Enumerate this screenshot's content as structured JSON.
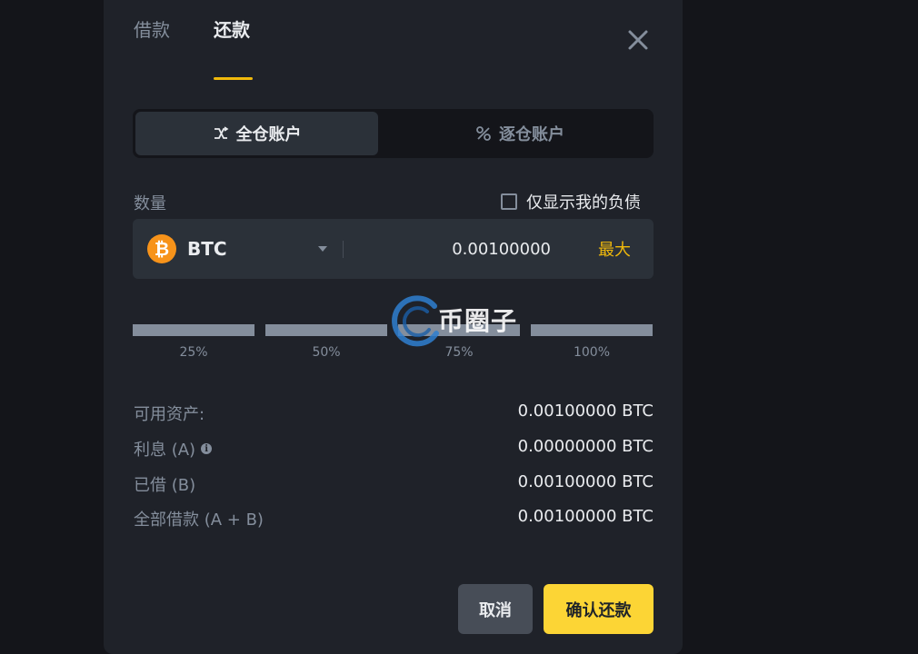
{
  "tabs": {
    "borrow": "借款",
    "repay": "还款"
  },
  "account_switch": {
    "cross": "全仓账户",
    "isolated": "逐仓账户"
  },
  "quantity": {
    "label": "数量",
    "debt_only_label": "仅显示我的负债",
    "coin": "BTC",
    "coin_symbol": "₿",
    "amount": "0.00100000",
    "max_label": "最大"
  },
  "slider": {
    "labels": [
      "25%",
      "50%",
      "75%",
      "100%"
    ]
  },
  "watermark": {
    "text": "币圈子"
  },
  "info": {
    "available_label": "可用资产:",
    "available_value": "0.00100000 BTC",
    "interest_label": "利息 (A)",
    "interest_value": "0.00000000 BTC",
    "borrowed_label": "已借 (B)",
    "borrowed_value": "0.00100000 BTC",
    "total_label": "全部借款 (A + B)",
    "total_value": "0.00100000 BTC"
  },
  "buttons": {
    "cancel": "取消",
    "confirm": "确认还款"
  },
  "colors": {
    "accent": "#f0b90b",
    "confirm_bg": "#fcd535",
    "modal_bg": "#1f2229",
    "page_bg": "#14151a"
  }
}
